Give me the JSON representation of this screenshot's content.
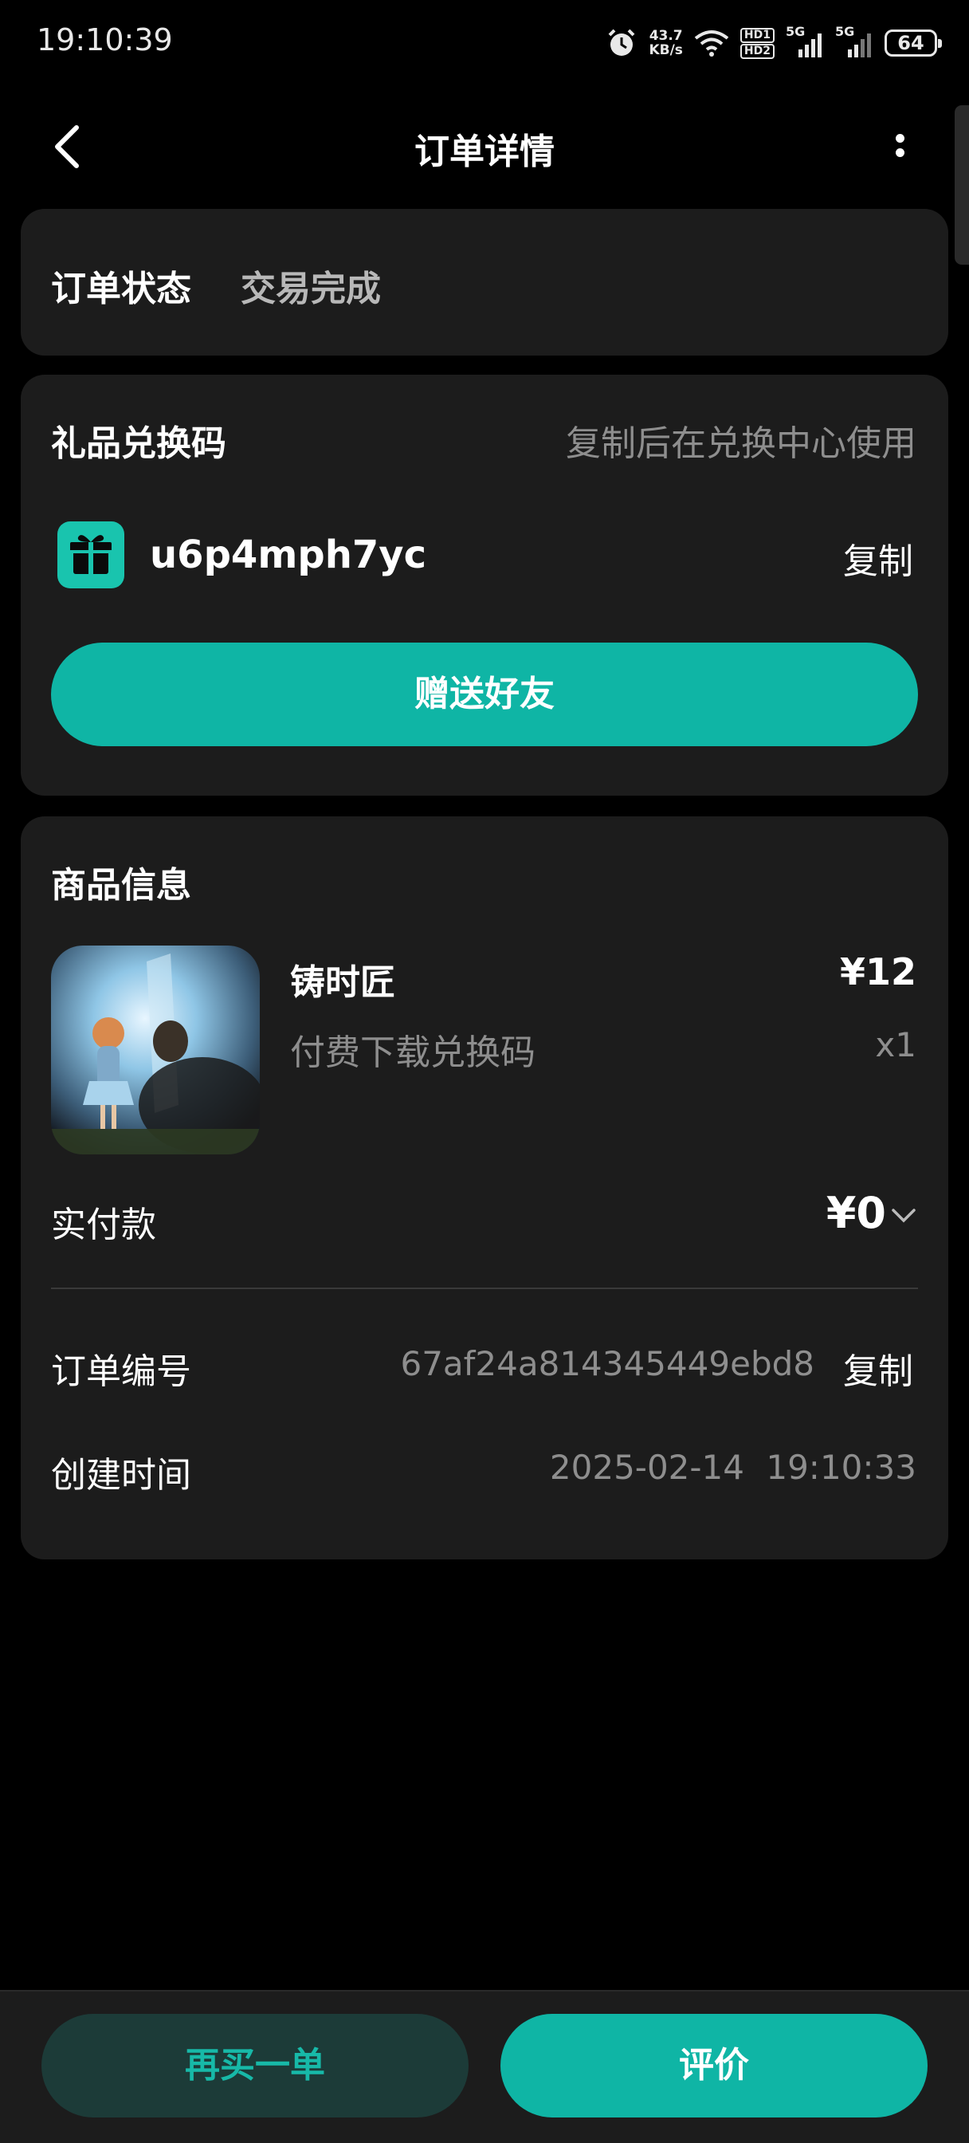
{
  "status_bar": {
    "time": "19:10:39",
    "net_speed_value": "43.7",
    "net_speed_unit": "KB/s",
    "hd1": "HD1",
    "hd2": "HD2",
    "sim1_label": "5G",
    "sim2_label": "5G",
    "battery": "64",
    "icons": [
      "alarm-icon",
      "wifi-icon",
      "signal-icon",
      "signal-icon",
      "battery-icon"
    ]
  },
  "header": {
    "title": "订单详情",
    "back_icon": "back-chevron-icon",
    "more_icon": "more-vertical-icon"
  },
  "order_status": {
    "label": "订单状态",
    "value": "交易完成"
  },
  "gift_code": {
    "title": "礼品兑换码",
    "hint": "复制后在兑换中心使用",
    "icon": "gift-icon",
    "code": "u6p4mph7yc",
    "copy_label": "复制",
    "send_button": "赠送好友"
  },
  "goods": {
    "title": "商品信息",
    "name": "铸时匠",
    "price": "¥12",
    "sku": "付费下载兑换码",
    "quantity": "x1",
    "paid_label": "实付款",
    "paid_value": "¥0",
    "order_no_label": "订单编号",
    "order_no": "67af24a814345449ebd8",
    "order_no_copy": "复制",
    "created_label": "创建时间",
    "created_date": "2025-02-14",
    "created_time": "19:10:33"
  },
  "bottom": {
    "rebuy": "再买一单",
    "review": "评价"
  },
  "colors": {
    "accent": "#0fb5a5",
    "card_bg": "#1c1c1c",
    "page_bg": "#000000"
  }
}
